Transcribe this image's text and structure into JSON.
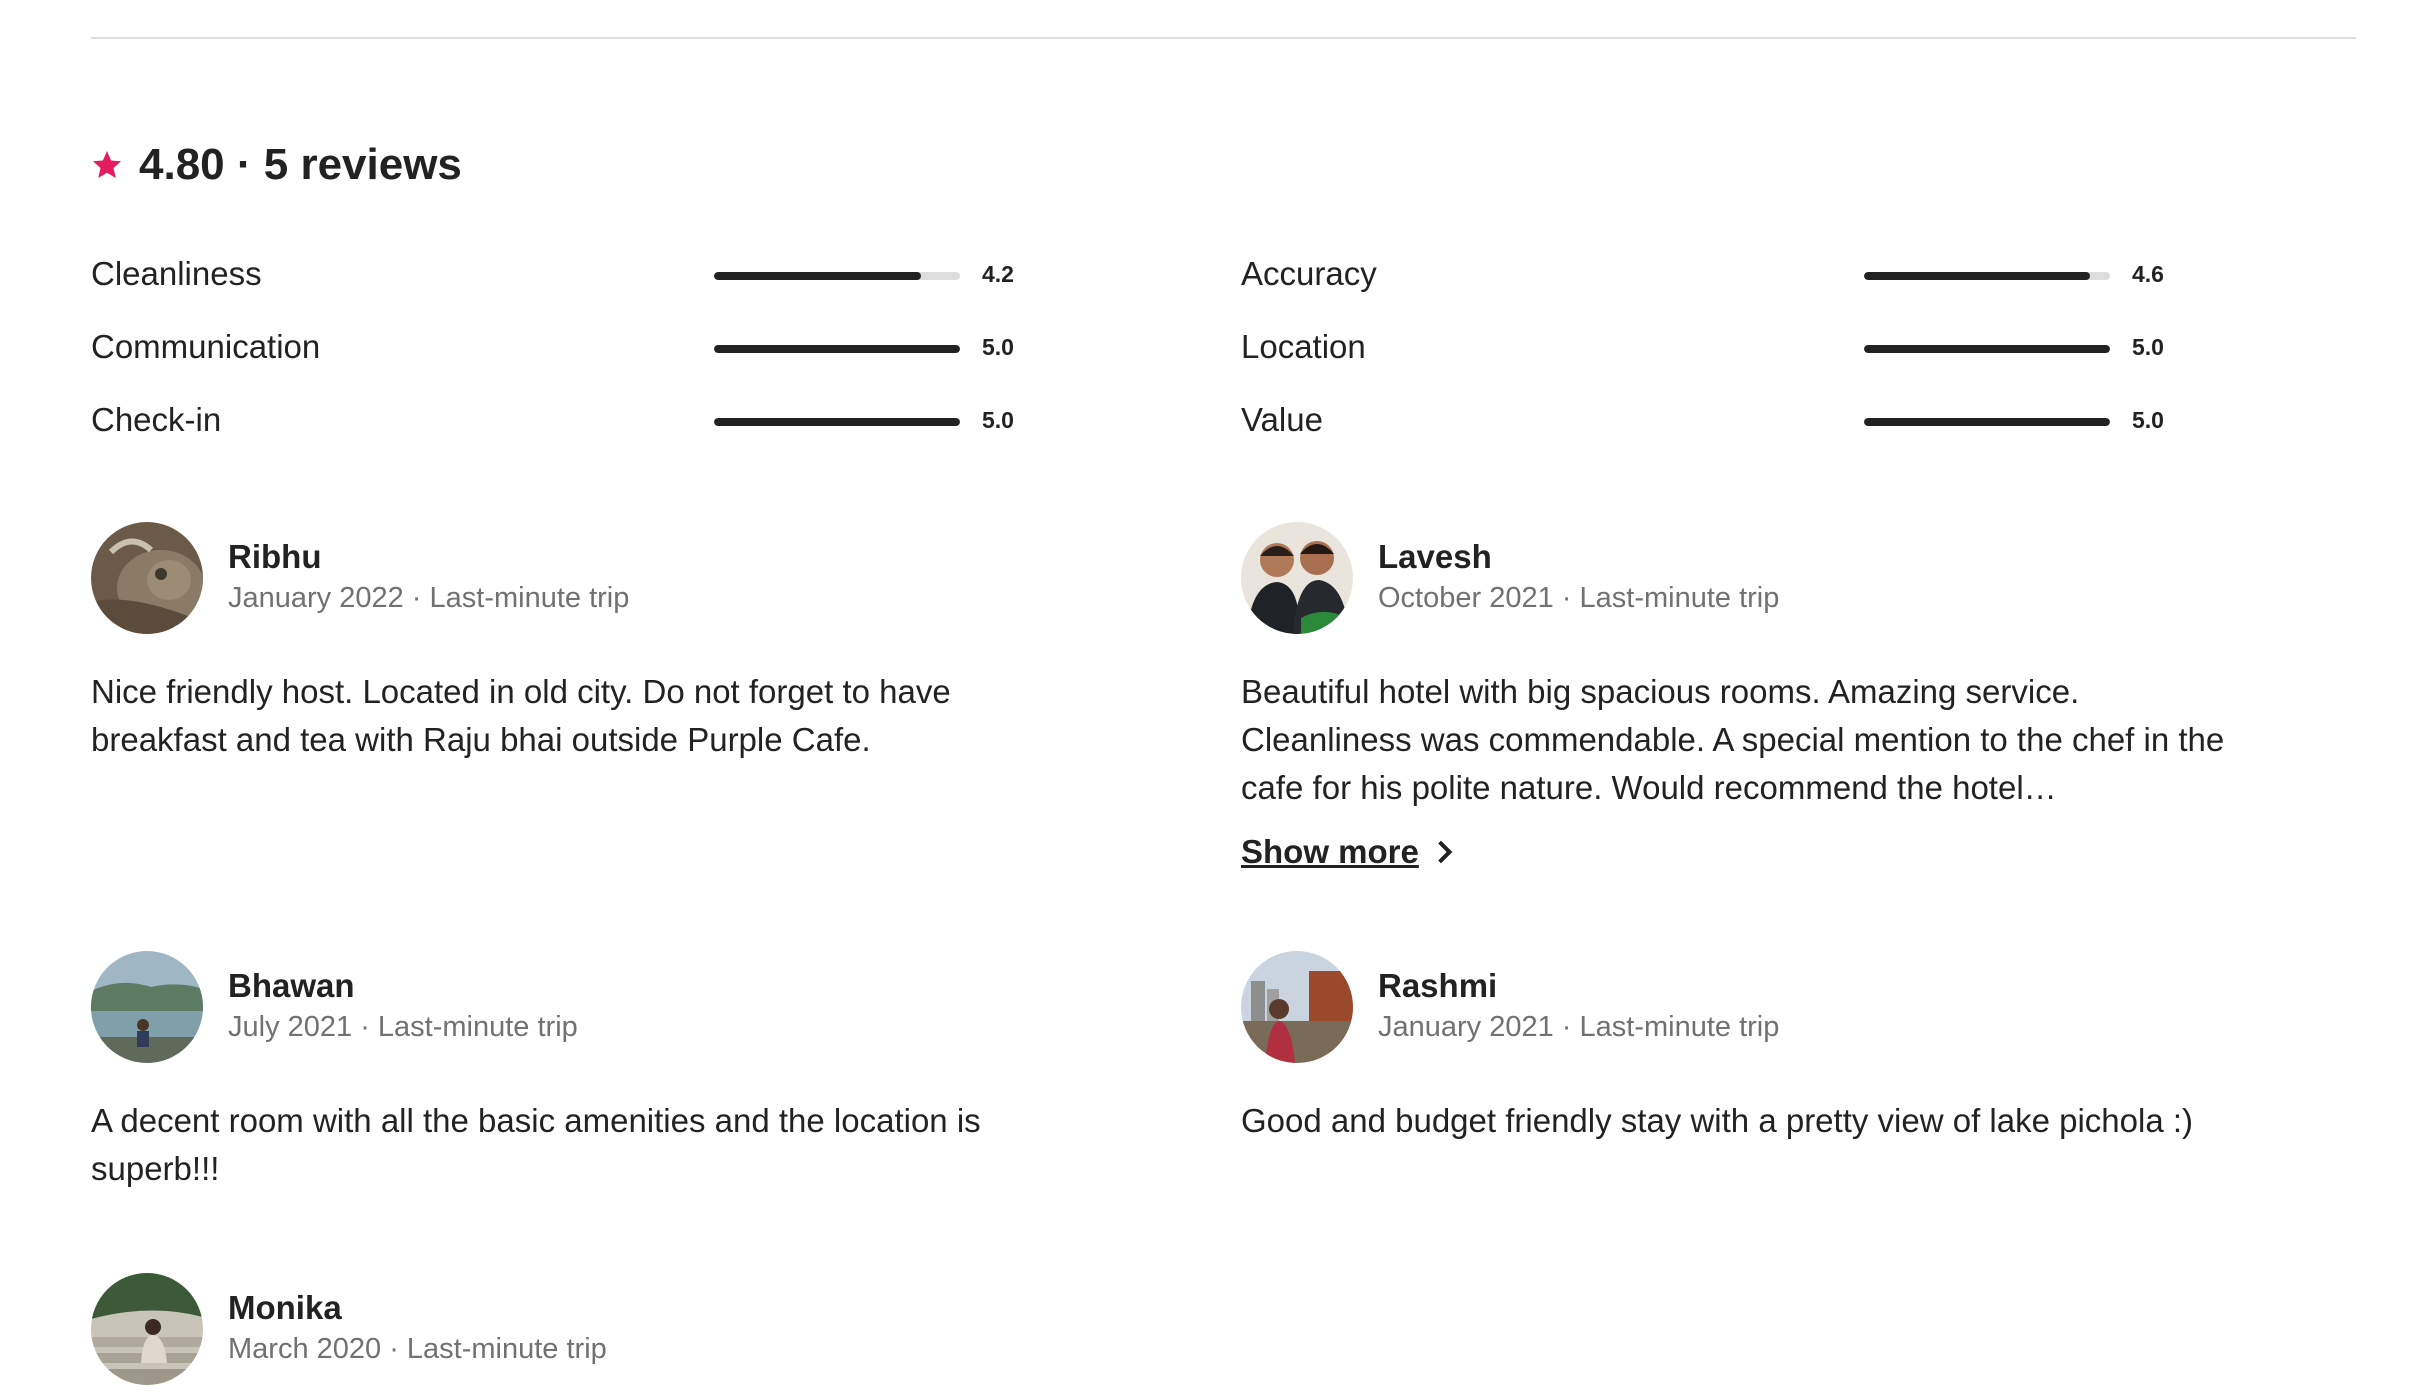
{
  "summary": {
    "rating": "4.80",
    "separator": " · ",
    "reviews_label": "5 reviews",
    "star_color": "#E31C5F",
    "icon": "star-icon"
  },
  "categories": [
    {
      "label": "Cleanliness",
      "score": "4.2",
      "fraction": 0.84
    },
    {
      "label": "Accuracy",
      "score": "4.6",
      "fraction": 0.92
    },
    {
      "label": "Communication",
      "score": "5.0",
      "fraction": 1.0
    },
    {
      "label": "Location",
      "score": "5.0",
      "fraction": 1.0
    },
    {
      "label": "Check-in",
      "score": "5.0",
      "fraction": 1.0
    },
    {
      "label": "Value",
      "score": "5.0",
      "fraction": 1.0
    }
  ],
  "reviews": [
    {
      "name": "Ribhu",
      "date": "January 2022 · Last-minute trip",
      "text": "Nice friendly host. Located in old city. Do not forget to have breakfast and tea with Raju bhai outside Purple Cafe."
    },
    {
      "name": "Lavesh",
      "date": "October 2021 · Last-minute trip",
      "text": "Beautiful hotel with big spacious rooms. Amazing service. Cleanliness was commendable. A special mention to the chef in the cafe for his polite nature. Would recommend the hotel…",
      "show_more": "Show more"
    },
    {
      "name": "Bhawan",
      "date": "July 2021 · Last-minute trip",
      "text": "A decent room with all the basic amenities and the location is superb!!!"
    },
    {
      "name": "Rashmi",
      "date": "January 2021 · Last-minute trip",
      "text": "Good and budget friendly stay with a pretty view of lake pichola :)"
    },
    {
      "name": "Monika",
      "date": "March 2020 · Last-minute trip",
      "text": ""
    }
  ],
  "colors": {
    "text": "#222222",
    "muted": "#717171",
    "bar_fill": "#222222",
    "bar_track": "#DDDDDD",
    "accent": "#E31C5F"
  }
}
